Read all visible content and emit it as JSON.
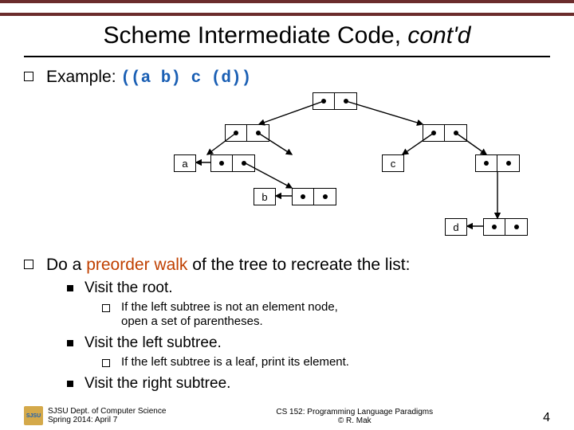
{
  "title": {
    "main": "Scheme Intermediate Code, ",
    "italic": "cont'd"
  },
  "example": {
    "prefix": "Example: ",
    "code": "((a b) c (d))"
  },
  "tree": {
    "a": "a",
    "b": "b",
    "c": "c",
    "d": "d"
  },
  "walk": {
    "prefix": "Do a ",
    "highlight": "preorder walk",
    "suffix": " of the tree to recreate the list:"
  },
  "steps": {
    "visit_root": "Visit the root.",
    "root_detail": "If the left subtree is not an element node,\nopen a set of parentheses.",
    "visit_left": "Visit the left subtree.",
    "left_detail": "If the left subtree is a leaf, print its element.",
    "visit_right": "Visit the right subtree."
  },
  "footer": {
    "dept": "SJSU Dept. of Computer Science",
    "term": "Spring 2014: April 7",
    "course": "CS 152: Programming Language Paradigms",
    "author": "© R. Mak",
    "page": "4"
  }
}
